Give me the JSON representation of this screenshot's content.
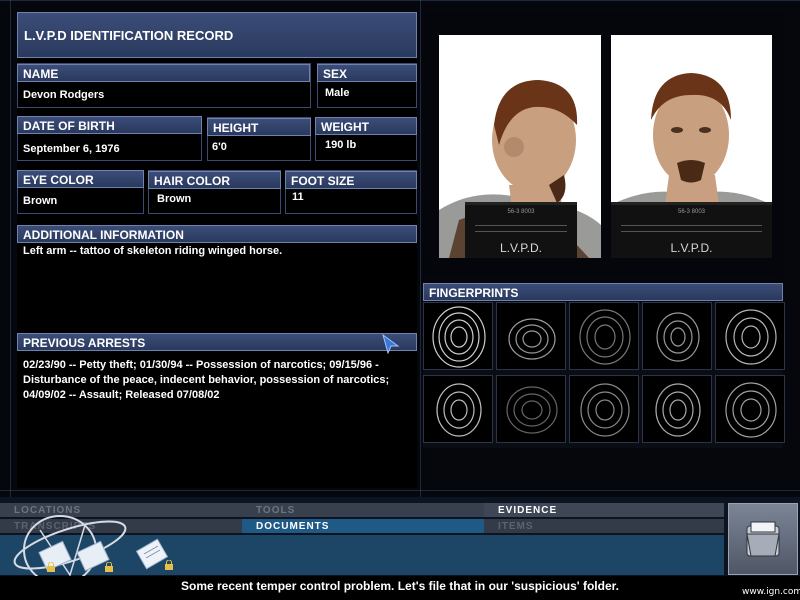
{
  "record": {
    "title": "L.V.P.D IDENTIFICATION RECORD",
    "name_label": "NAME",
    "name": "Devon Rodgers",
    "sex_label": "SEX",
    "sex": "Male",
    "dob_label": "DATE OF BIRTH",
    "dob": "September 6, 1976",
    "height_label": "HEIGHT",
    "height": "6'0",
    "weight_label": "WEIGHT",
    "weight": "190 lb",
    "eye_label": "EYE COLOR",
    "eye": "Brown",
    "hair_label": "HAIR COLOR",
    "hair": "Brown",
    "foot_label": "FOOT SIZE",
    "foot": "11",
    "additional_label": "ADDITIONAL INFORMATION",
    "additional": "Left arm -- tattoo of skeleton riding winged horse.",
    "arrests_label": "PREVIOUS ARRESTS",
    "arrests": "02/23/90 -- Petty theft; 01/30/94 -- Possession of narcotics; 09/15/96 - Disturbance of the peace, indecent behavior, possession of narcotics; 04/09/02 -- Assault; Released 07/08/02"
  },
  "photos": {
    "plate_label": "L.V.P.D.",
    "plate_small": "56-3 8003"
  },
  "fingerprints": {
    "label": "FINGERPRINTS"
  },
  "nav": {
    "locations": "LOCATIONS",
    "tools": "TOOLS",
    "evidence": "EVIDENCE",
    "transcripts": "TRANSCRIPTS",
    "documents": "DOCUMENTS",
    "items": "ITEMS"
  },
  "status": "Some recent temper control problem. Let's file that in our 'suspicious' folder.",
  "watermark": "www.ign.com",
  "colors": {
    "header": "#2f3f66",
    "header_border": "#6f82ad",
    "nav_bar": "#1d4666",
    "accent": "#4a84c4"
  }
}
